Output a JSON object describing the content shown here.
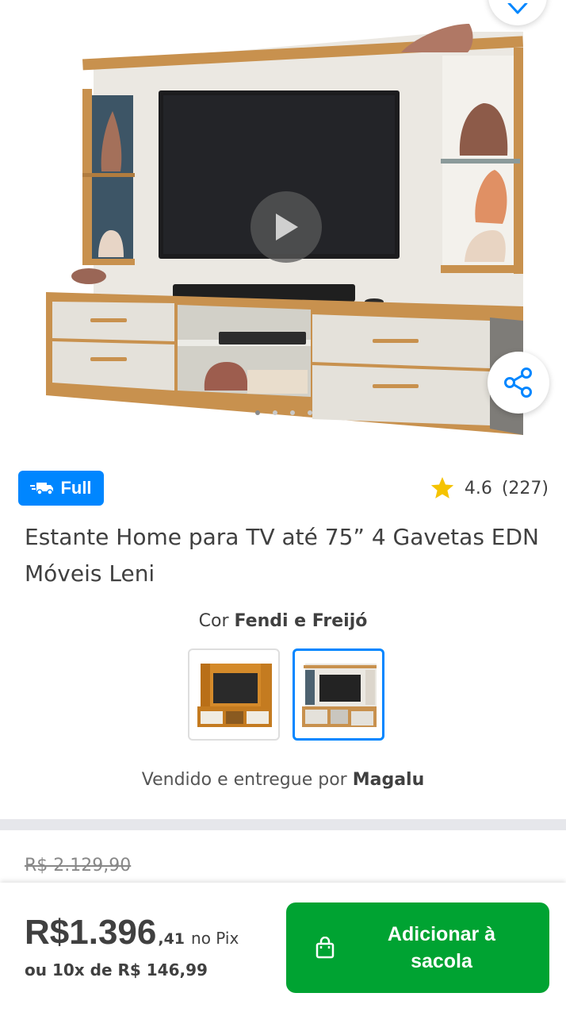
{
  "gallery": {
    "image_alt": "Estante Home para TV",
    "dots": [
      true,
      false,
      false,
      false
    ]
  },
  "badge": {
    "label": "Full",
    "color": "#0086ff"
  },
  "rating": {
    "value": "4.6",
    "count": "(227)",
    "star_color": "#f5c300"
  },
  "product": {
    "title": "Estante Home para TV até 75” 4 Gavetas EDN Móveis Leni"
  },
  "color": {
    "prefix": "Cor",
    "selected": "Fendi e Freijó",
    "options": [
      "Freijó",
      "Fendi e Freijó"
    ]
  },
  "seller": {
    "prefix": "Vendido e entregue por",
    "name": "Magalu"
  },
  "pricing": {
    "old_price": "R$ 2.129,90",
    "price_main": "R$1.396",
    "price_cents": ",41",
    "pix_label": "no Pix",
    "installments": "ou 10x de R$ 146,99"
  },
  "cta": {
    "label": "Adicionar à sacola",
    "color": "#00a332"
  },
  "icons": {
    "favorite": "heart-icon",
    "play": "play-icon",
    "share": "share-icon",
    "truck": "truck-icon",
    "star": "star-icon",
    "bag": "shopping-bag-icon"
  }
}
